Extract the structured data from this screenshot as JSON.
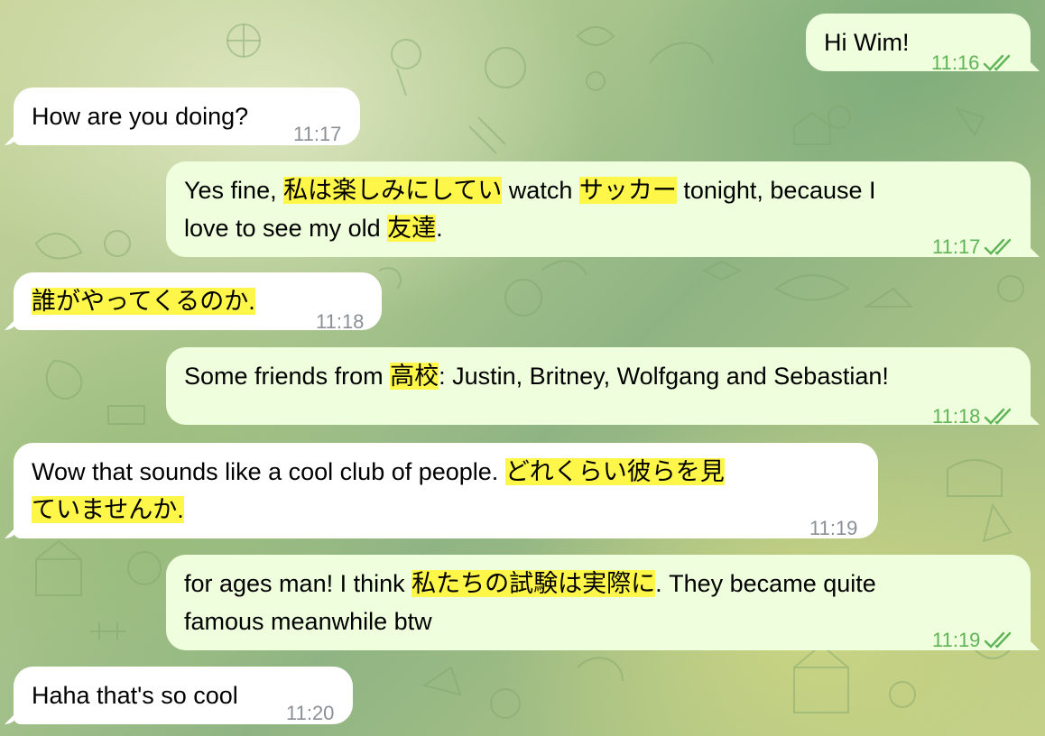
{
  "colors": {
    "outgoing_bubble": "#effedd",
    "incoming_bubble": "#ffffff",
    "highlight": "#fff64a",
    "outgoing_time": "#5fb457",
    "incoming_time": "#8a9096"
  },
  "messages": [
    {
      "direction": "out",
      "time": "11:16",
      "status_icon": "double-check-icon",
      "lines": [
        [
          {
            "t": "Hi Wim!",
            "hl": false
          }
        ]
      ]
    },
    {
      "direction": "in",
      "time": "11:17",
      "lines": [
        [
          {
            "t": "How are you doing?",
            "hl": false
          }
        ]
      ]
    },
    {
      "direction": "out",
      "time": "11:17",
      "status_icon": "double-check-icon",
      "lines": [
        [
          {
            "t": "Yes fine, ",
            "hl": false
          },
          {
            "t": "私は楽しみにしてい",
            "hl": true
          },
          {
            "t": " watch ",
            "hl": false
          },
          {
            "t": "サッカー",
            "hl": true
          },
          {
            "t": " tonight, because I",
            "hl": false
          }
        ],
        [
          {
            "t": "love to see my old ",
            "hl": false
          },
          {
            "t": "友達",
            "hl": true
          },
          {
            "t": ".",
            "hl": false
          }
        ]
      ]
    },
    {
      "direction": "in",
      "time": "11:18",
      "lines": [
        [
          {
            "t": "誰がやってくるのか.",
            "hl": true
          }
        ]
      ]
    },
    {
      "direction": "out",
      "time": "11:18",
      "status_icon": "double-check-icon",
      "lines": [
        [
          {
            "t": "Some friends from ",
            "hl": false
          },
          {
            "t": "高校",
            "hl": true
          },
          {
            "t": ": Justin, Britney, Wolfgang and Sebastian!",
            "hl": false
          }
        ]
      ]
    },
    {
      "direction": "in",
      "time": "11:19",
      "lines": [
        [
          {
            "t": "Wow that sounds like a cool club of people. ",
            "hl": false
          },
          {
            "t": "どれくらい彼らを見",
            "hl": true
          }
        ],
        [
          {
            "t": "ていませんか.",
            "hl": true
          }
        ]
      ]
    },
    {
      "direction": "out",
      "time": "11:19",
      "status_icon": "double-check-icon",
      "lines": [
        [
          {
            "t": "for ages man! I think ",
            "hl": false
          },
          {
            "t": "私たちの試験は実際に",
            "hl": true
          },
          {
            "t": ". They became quite",
            "hl": false
          }
        ],
        [
          {
            "t": "famous meanwhile btw",
            "hl": false
          }
        ]
      ]
    },
    {
      "direction": "in",
      "time": "11:20",
      "lines": [
        [
          {
            "t": "Haha that's so cool",
            "hl": false
          }
        ]
      ]
    }
  ]
}
